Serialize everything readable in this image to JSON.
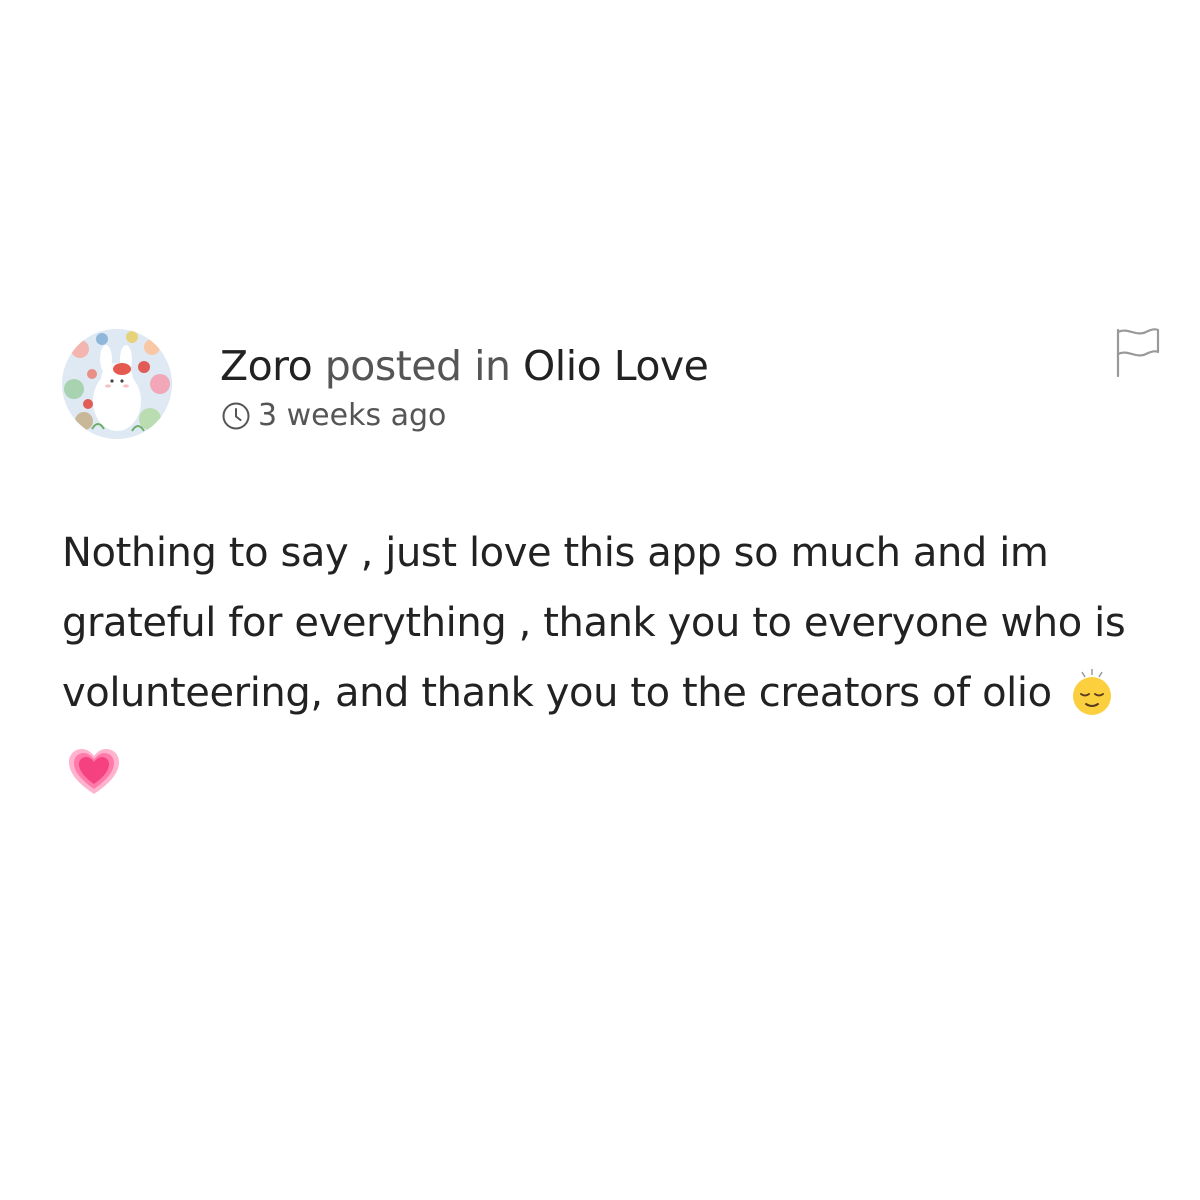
{
  "post": {
    "author": "Zoro",
    "action": "posted in",
    "group": "Olio Love",
    "time_ago": "3 weeks ago",
    "body_text": "Nothing to say , just love this app so much and im grateful for everything , thank you to everyone who is volunteering, and thank you to the creators of olio",
    "emojis": [
      "relieved-face",
      "growing-heart"
    ]
  },
  "icons": {
    "avatar": "avatar-illustration",
    "time": "clock-icon",
    "report": "flag-icon"
  },
  "colors": {
    "text_primary": "#222222",
    "text_secondary": "#555555",
    "flag_stroke": "#999999",
    "background": "#ffffff"
  }
}
